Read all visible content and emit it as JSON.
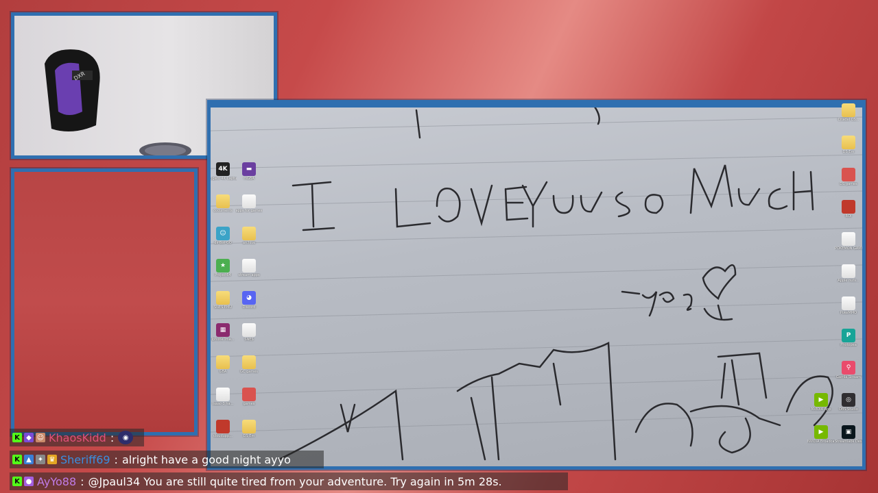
{
  "screen_text": {
    "handwriting_main": "I LOVE YOU SO MUCH",
    "handwriting_signature": "-yeye"
  },
  "desktop_icons_left": [
    {
      "label": "Elgato 4K Capture",
      "icon": "camera-icon",
      "color": "#222222"
    },
    {
      "label": "mGBA",
      "icon": "gameboy-icon",
      "color": "#6b3fa0"
    },
    {
      "label": "documents",
      "icon": "folder-icon",
      "color": "#f2d06b"
    },
    {
      "label": "apps for games",
      "icon": "file-icon",
      "color": "#f4f4f4"
    },
    {
      "label": "dx Bot GO",
      "icon": "robot-icon",
      "color": "#3ba3c7"
    },
    {
      "label": "archive",
      "icon": "folder-icon",
      "color": "#f2d06b"
    },
    {
      "label": "Project64",
      "icon": "n64-icon",
      "color": "#4caf50"
    },
    {
      "label": "stream apps",
      "icon": "file-icon",
      "color": "#f4f4f4"
    },
    {
      "label": "SNES EMU",
      "icon": "folder-icon",
      "color": "#f2d06b"
    },
    {
      "label": "Discord",
      "icon": "discord-icon",
      "color": "#5865f2"
    },
    {
      "label": "Iphone Ima...",
      "icon": "winrar-icon",
      "color": "#8b2b6e"
    },
    {
      "label": "SNES",
      "icon": "file-icon",
      "color": "#f4f4f4"
    },
    {
      "label": "GBA",
      "icon": "folder-icon",
      "color": "#f2d06b"
    },
    {
      "label": "GC games",
      "icon": "folder-icon",
      "color": "#f2d06b"
    },
    {
      "label": "Isaac-3 ha...",
      "icon": "file-icon",
      "color": "#f4f4f4"
    },
    {
      "label": "games",
      "icon": "file-icon",
      "color": "#d9534f"
    },
    {
      "label": "cloudupp...",
      "icon": "file-icon",
      "color": "#c0392b"
    },
    {
      "label": "DS Em",
      "icon": "folder-icon",
      "color": "#f2d06b"
    }
  ],
  "desktop_icons_right": [
    {
      "label": "Citadel OS...",
      "icon": "folder-icon",
      "color": "#f2d06b"
    },
    {
      "label": "DS Em",
      "icon": "folder-icon",
      "color": "#f2d06b"
    },
    {
      "label": "DS games",
      "icon": "file-icon",
      "color": "#d9534f"
    },
    {
      "label": "ROI",
      "icon": "file-icon",
      "color": "#c0392b"
    },
    {
      "label": "POKEMON GAMES",
      "icon": "file-icon",
      "color": "#f4f4f4"
    },
    {
      "label": "Apple nuts...",
      "icon": "file-icon",
      "color": "#f4f4f4"
    },
    {
      "label": "PokeMMO",
      "icon": "file-icon",
      "color": "#f4f4f4"
    },
    {
      "label": "Photopea",
      "icon": "photopea-icon",
      "color": "#18a497"
    },
    {
      "label": "Gamla Stream",
      "icon": "pin-icon",
      "color": "#e94b6c"
    },
    {
      "label": "NVIDIA App",
      "icon": "nvidia-icon",
      "color": "#76b900"
    },
    {
      "label": "OBS Studio",
      "icon": "obs-icon",
      "color": "#302e31"
    },
    {
      "label": "NVIDIA Broadcast",
      "icon": "nvidia-icon",
      "color": "#76b900"
    },
    {
      "label": "Streamlabs Desktop",
      "icon": "streamlabs-icon",
      "color": "#09161d"
    }
  ],
  "chat": [
    {
      "user": "KhaosKidd",
      "user_color": "#e0507a",
      "message": "",
      "emote": true,
      "badges": [
        {
          "icon": "kick-icon",
          "color": "#53fc18",
          "glyph": "K"
        },
        {
          "icon": "cube-icon",
          "color": "#7a4cd6",
          "glyph": "◆"
        },
        {
          "icon": "avatar-icon",
          "color": "#c98a6a",
          "glyph": "☺"
        }
      ]
    },
    {
      "user": "Sheriff69",
      "user_color": "#3a8fe0",
      "message": "alright have a good night ayyo",
      "emote": false,
      "badges": [
        {
          "icon": "kick-icon",
          "color": "#53fc18",
          "glyph": "K"
        },
        {
          "icon": "photo-icon",
          "color": "#3a7fd6",
          "glyph": "▲"
        },
        {
          "icon": "sword-icon",
          "color": "#888888",
          "glyph": "✦"
        },
        {
          "icon": "crown-icon",
          "color": "#e3a623",
          "glyph": "♛"
        }
      ]
    },
    {
      "user": "AyYo88",
      "user_color": "#c07ce8",
      "message": "@Jpaul34 You are still quite tired from your adventure. Try again in 5m 28s.",
      "emote": false,
      "badges": [
        {
          "icon": "kick-icon",
          "color": "#53fc18",
          "glyph": "K"
        },
        {
          "icon": "mic-icon",
          "color": "#a45fe0",
          "glyph": "●"
        }
      ]
    }
  ],
  "chat_separator": ":"
}
